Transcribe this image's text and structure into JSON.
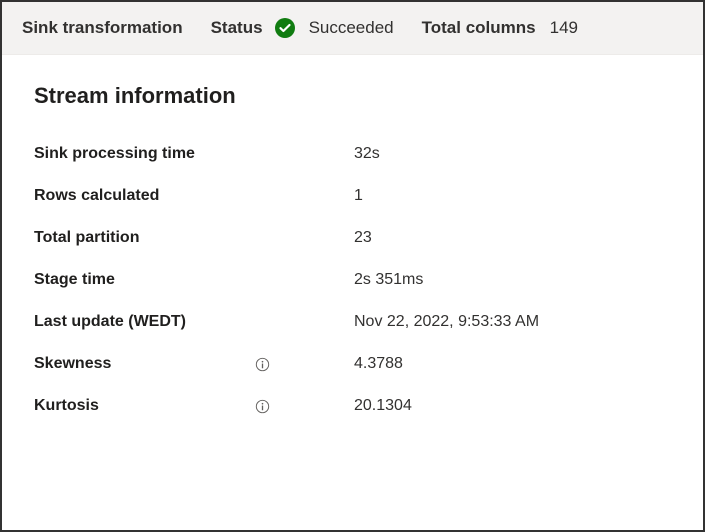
{
  "header": {
    "transformation_label": "Sink transformation",
    "status_label": "Status",
    "status_value": "Succeeded",
    "status_color": "#107c10",
    "total_columns_label": "Total columns",
    "total_columns_value": "149"
  },
  "stream_info": {
    "title": "Stream information",
    "rows": [
      {
        "label": "Sink processing time",
        "value": "32s",
        "has_info_icon": false
      },
      {
        "label": "Rows calculated",
        "value": "1",
        "has_info_icon": false
      },
      {
        "label": "Total partition",
        "value": "23",
        "has_info_icon": false
      },
      {
        "label": "Stage time",
        "value": "2s 351ms",
        "has_info_icon": false
      },
      {
        "label": "Last update (WEDT)",
        "value": "Nov 22, 2022, 9:53:33 AM",
        "has_info_icon": false
      },
      {
        "label": "Skewness",
        "value": "4.3788",
        "has_info_icon": true
      },
      {
        "label": "Kurtosis",
        "value": "20.1304",
        "has_info_icon": true
      }
    ]
  }
}
